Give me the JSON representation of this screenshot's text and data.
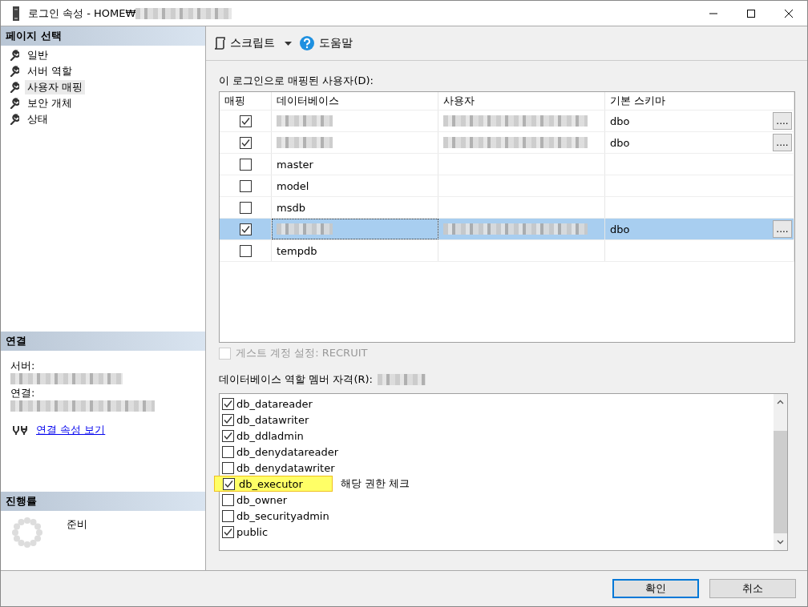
{
  "window": {
    "title": "로그인 속성 - HOME₩",
    "title_redacted": true
  },
  "sidebar": {
    "header": "페이지 선택",
    "items": [
      {
        "label": "일반",
        "selected": false
      },
      {
        "label": "서버 역할",
        "selected": false
      },
      {
        "label": "사용자 매핑",
        "selected": true
      },
      {
        "label": "보안 개체",
        "selected": false
      },
      {
        "label": "상태",
        "selected": false
      }
    ]
  },
  "connection": {
    "header": "연결",
    "fields": [
      {
        "label": "서버:",
        "value_redacted": true
      },
      {
        "label": "연결:",
        "value_redacted": true
      }
    ],
    "link": "연결 속성 보기"
  },
  "progress": {
    "header": "진행률",
    "status": "준비"
  },
  "toolbar": {
    "items": [
      {
        "label": "스크립트",
        "kind": "script"
      },
      {
        "label": "도움말",
        "kind": "help"
      }
    ]
  },
  "user_mapping": {
    "label": "이 로그인으로 매핑된 사용자(D):",
    "columns": [
      "매핑",
      "데이터베이스",
      "사용자",
      "기본 스키마"
    ],
    "rows": [
      {
        "mapped": true,
        "database_redacted": true,
        "user_redacted": true,
        "schema": "dbo",
        "browse": "....",
        "selected": false
      },
      {
        "mapped": true,
        "database_redacted": true,
        "user_redacted": true,
        "schema": "dbo",
        "browse": "....",
        "selected": false
      },
      {
        "mapped": false,
        "database": "master",
        "selected": false
      },
      {
        "mapped": false,
        "database": "model",
        "selected": false
      },
      {
        "mapped": false,
        "database": "msdb",
        "selected": false
      },
      {
        "mapped": true,
        "database_redacted": true,
        "user_redacted": true,
        "schema": "dbo",
        "browse": "....",
        "selected": true
      },
      {
        "mapped": false,
        "database": "tempdb",
        "selected": false
      }
    ]
  },
  "guest": {
    "label": "게스트 계정 설정: RECRUIT",
    "checked": false,
    "disabled": true
  },
  "roles": {
    "label": "데이터베이스 역할 멤버 자격(R):",
    "label_redacted": true,
    "items": [
      {
        "name": "db_datareader",
        "checked": true,
        "highlighted": false
      },
      {
        "name": "db_datawriter",
        "checked": true,
        "highlighted": false
      },
      {
        "name": "db_ddladmin",
        "checked": true,
        "highlighted": false
      },
      {
        "name": "db_denydatareader",
        "checked": false,
        "highlighted": false
      },
      {
        "name": "db_denydatawriter",
        "checked": false,
        "highlighted": false
      },
      {
        "name": "db_executor",
        "checked": true,
        "highlighted": true,
        "note": "해당 권한 체크"
      },
      {
        "name": "db_owner",
        "checked": false,
        "highlighted": false
      },
      {
        "name": "db_securityadmin",
        "checked": false,
        "highlighted": false
      },
      {
        "name": "public",
        "checked": true,
        "highlighted": false
      }
    ]
  },
  "buttons": [
    {
      "label": "확인",
      "default": true
    },
    {
      "label": "취소",
      "default": false
    }
  ]
}
